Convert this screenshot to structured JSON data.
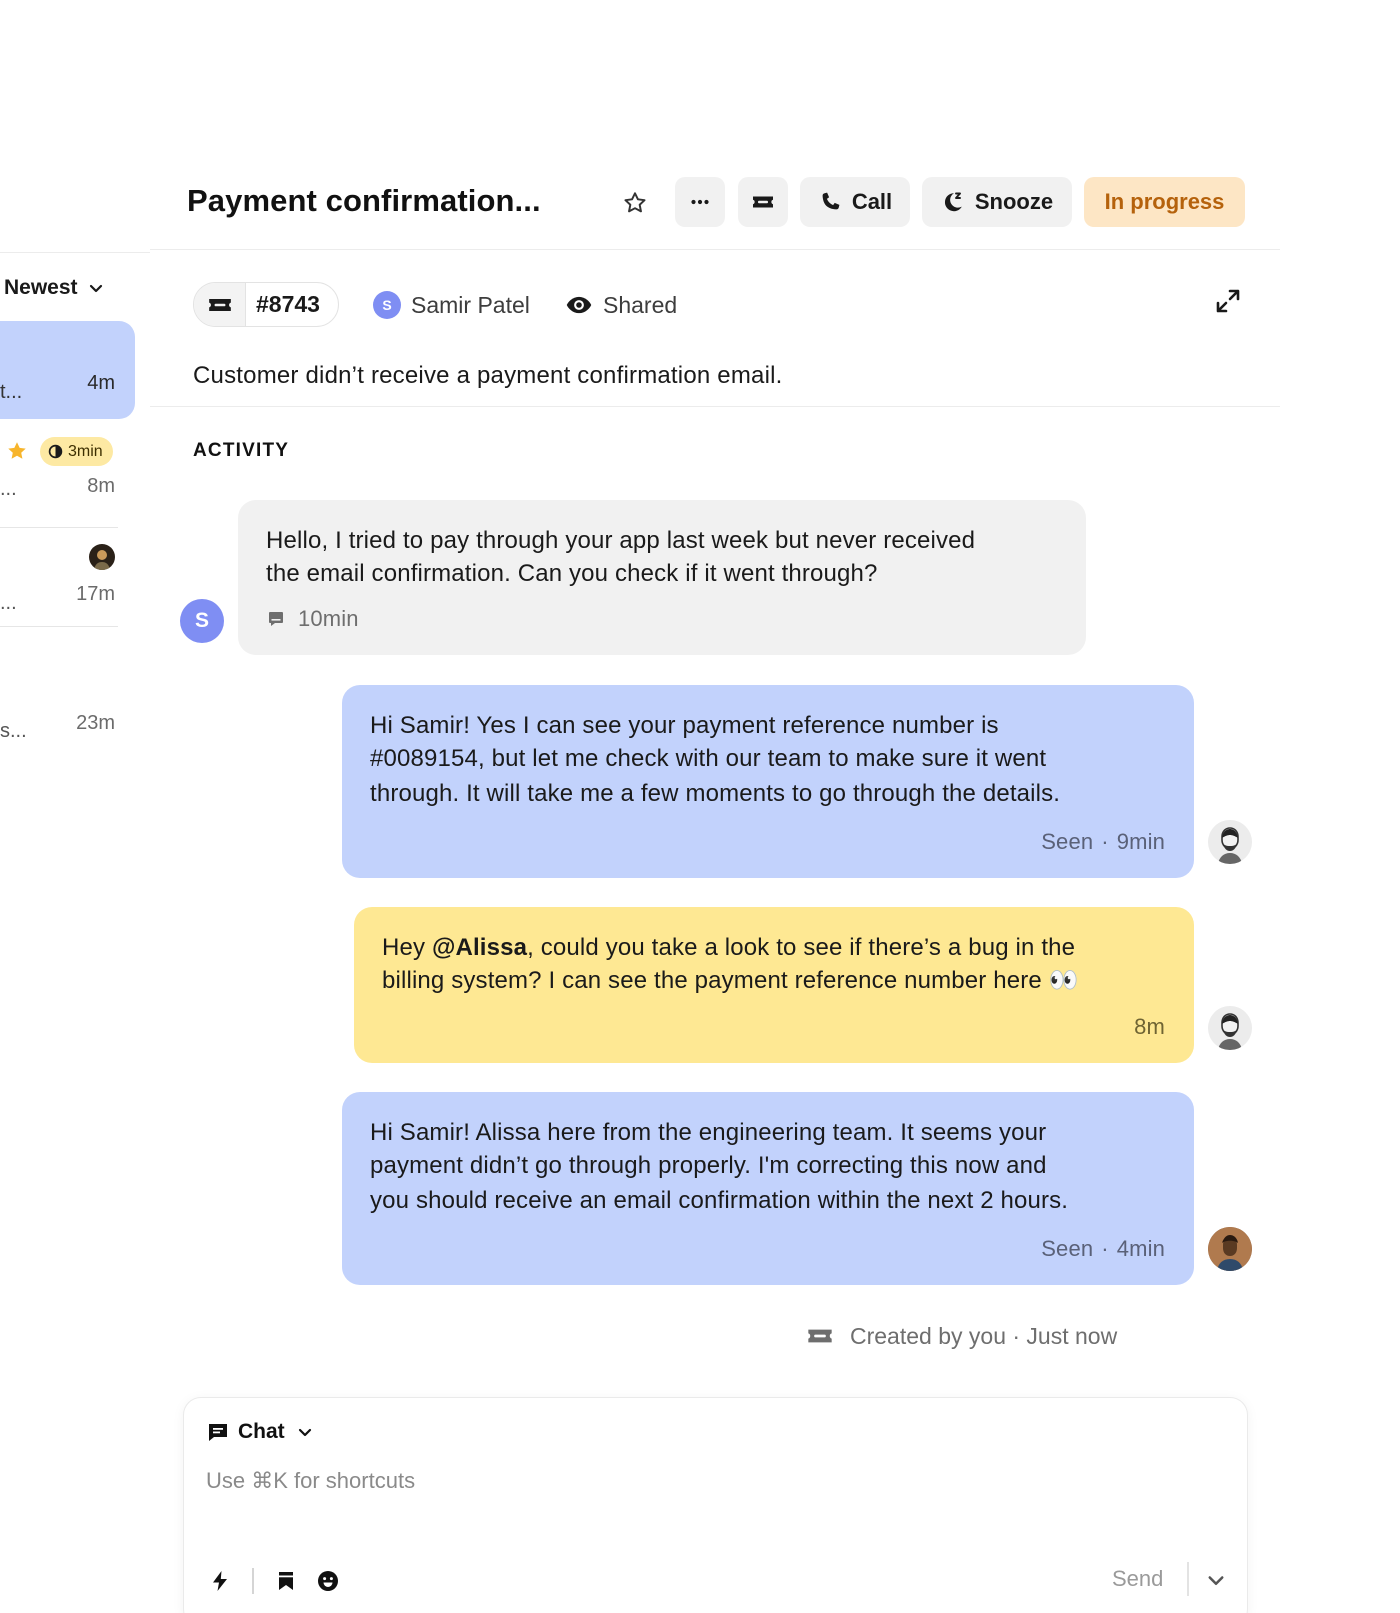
{
  "list": {
    "sort_label": "Newest",
    "items": [
      {
        "preview": "t...",
        "time": "4m"
      },
      {
        "preview": "...",
        "time": "8m",
        "badge": "3min"
      },
      {
        "preview": "...",
        "time": "17m"
      },
      {
        "preview": "s...",
        "time": "23m"
      }
    ]
  },
  "header": {
    "title": "Payment confirmation...",
    "call_label": "Call",
    "snooze_label": "Snooze",
    "status_label": "In progress"
  },
  "ticket": {
    "number": "#8743",
    "assignee_initial": "S",
    "assignee_name": "Samir Patel",
    "visibility": "Shared",
    "summary": "Customer didn’t receive a payment confirmation email."
  },
  "activity": {
    "label": "ACTIVITY",
    "messages": [
      {
        "lines": [
          "Hello, I tried to pay through your app last week but never received",
          "the email confirmation. Can you check if it went through?"
        ],
        "time": "10min",
        "avatar_initial": "S"
      },
      {
        "lines": [
          "Hi Samir! Yes I can see your payment reference number is",
          "#0089154, but let me check with our team to make sure it went",
          "through. It will take me a few moments to go through the details."
        ],
        "status": "Seen",
        "sep": "·",
        "time": "9min"
      },
      {
        "prefix": "Hey ",
        "mention": "@Alissa",
        "rest": ", could you take a look to see if there’s a bug in the",
        "line2": "billing system? I can see the payment reference number here 👀",
        "time": "8m"
      },
      {
        "lines": [
          "Hi Samir! Alissa here from the engineering team. It seems your",
          "payment didn’t go through properly. I'm correcting this now and",
          "you should receive an email confirmation within the next 2 hours."
        ],
        "status": "Seen",
        "sep": "·",
        "time": "4min"
      }
    ],
    "created_text": "Created by you · Just now"
  },
  "composer": {
    "channel": "Chat",
    "placeholder": "Use ⌘K for shortcuts",
    "send_label": "Send"
  },
  "colors": {
    "customer_bubble": "#f1f1f1",
    "agent_bubble": "#c2d2fc",
    "internal_note": "#fee893",
    "status_bg": "#fde6c5",
    "status_text": "#b5620c",
    "avatar_purple": "#7f8ef3"
  },
  "icons": [
    "chevron-down-icon",
    "star-icon",
    "more-icon",
    "ticket-icon",
    "phone-icon",
    "snooze-icon",
    "eye-icon",
    "expand-icon",
    "note-icon",
    "chat-icon",
    "bolt-icon",
    "bookmark-icon",
    "emoji-icon",
    "clock-half-icon"
  ]
}
